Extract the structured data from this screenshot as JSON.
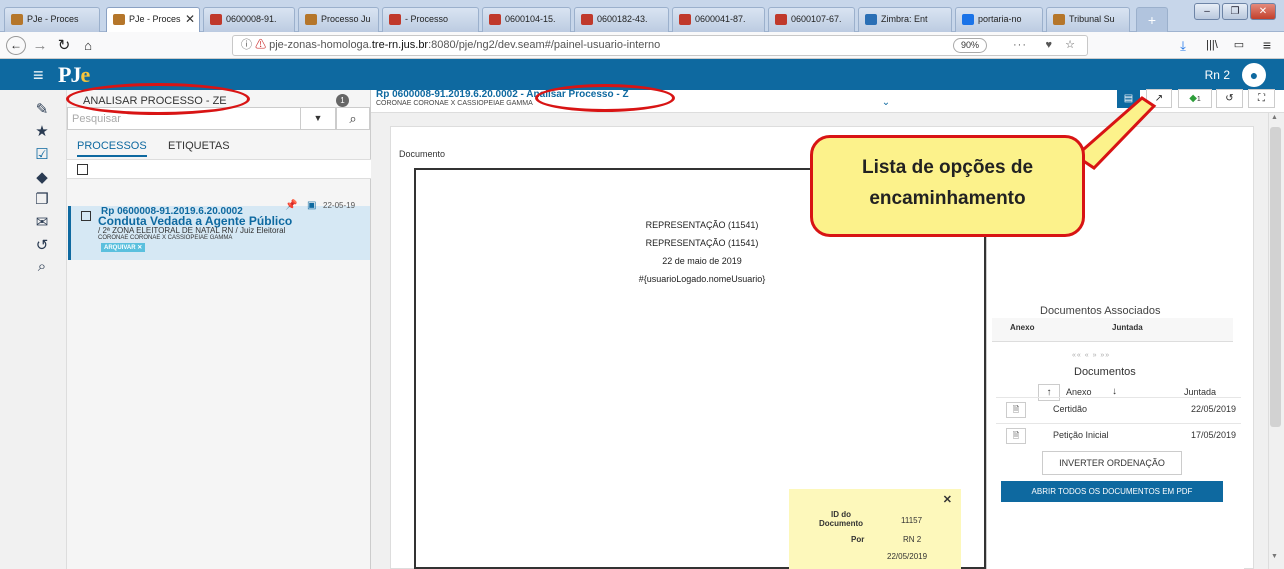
{
  "browser": {
    "tabs": [
      {
        "label": "PJe - Proces",
        "icon": "pje-icon",
        "color": "#b5762a"
      },
      {
        "label": "PJe - Proces",
        "icon": "pje-icon",
        "color": "#b5762a",
        "active": true
      },
      {
        "label": "0600008-91.",
        "icon": "doc-icon",
        "color": "#c0392b"
      },
      {
        "label": "Processo Ju",
        "icon": "pje-icon",
        "color": "#b5762a"
      },
      {
        "label": "- Processo",
        "icon": "doc-icon",
        "color": "#c0392b"
      },
      {
        "label": "0600104-15.",
        "icon": "doc-icon",
        "color": "#c0392b"
      },
      {
        "label": "0600182-43.",
        "icon": "doc-icon",
        "color": "#c0392b"
      },
      {
        "label": "0600041-87.",
        "icon": "doc-icon",
        "color": "#c0392b"
      },
      {
        "label": "0600107-67.",
        "icon": "doc-icon",
        "color": "#c0392b"
      },
      {
        "label": "Zimbra: Ent",
        "icon": "zimbra-icon",
        "color": "#2a6fb5"
      },
      {
        "label": "portaria-no",
        "icon": "search-icon",
        "color": "#1a73e8"
      },
      {
        "label": "Tribunal Su",
        "icon": "pje-icon",
        "color": "#b5762a"
      }
    ],
    "url_prefix": "pje-zonas-homologa.",
    "url_domain": "tre-rn.jus.br",
    "url_rest": ":8080/pje/ng2/dev.seam#/painel-usuario-interno",
    "zoom": "90%"
  },
  "app": {
    "logo_p": "PJ",
    "logo_e": "e",
    "user": "Rn 2"
  },
  "panel": {
    "title": "ANALISAR PROCESSO - ZE",
    "count": "1",
    "search_placeholder": "Pesquisar",
    "tab_processos": "PROCESSOS",
    "tab_etiquetas": "ETIQUETAS",
    "card": {
      "number": "Rp 0600008-91.2019.6.20.0002",
      "title": "Conduta Vedada a Agente Público",
      "org": "/ 2ª ZONA ELEITORAL DE NATAL RN / Juiz Eleitoral",
      "parts": "CORONAE CORONAE X CASSIOPEIAE GAMMA",
      "tag": "ARQUIVAR ✕",
      "date": "22-05-19"
    }
  },
  "process": {
    "number": "Rp 0600008-91.2019.6.20.0002 - Analisar Processo - Z",
    "parts": "CORONAE CORONAE X CASSIOPEIAE GAMMA",
    "tag_count": "1"
  },
  "document": {
    "label": "Documento",
    "lines": [
      "REPRESENTAÇÃO (11541)",
      "REPRESENTAÇÃO (11541)",
      "22 de maio de 2019",
      "#{usuarioLogado.nomeUsuario}"
    ],
    "sig_id_label": "ID do Documento",
    "sig_id_value": "11157",
    "sig_por_label": "Por",
    "sig_por_value": "RN 2",
    "sig_date": "22/05/2019"
  },
  "docs_panel": {
    "assoc_title": "Documentos Associados",
    "col_anexo": "Anexo",
    "col_juntada": "Juntada",
    "pager": "«« « » »»",
    "docs_title": "Documentos",
    "rows": [
      {
        "name": "Certidão",
        "date": "22/05/2019"
      },
      {
        "name": "Petição Inicial",
        "date": "17/05/2019"
      }
    ],
    "invert_label": "INVERTER ORDENAÇÃO",
    "pdf_label": "ABRIR TODOS OS DOCUMENTOS EM PDF"
  },
  "annotation": {
    "callout": "Lista de opções de encaminhamento",
    "color": "#d81414"
  }
}
